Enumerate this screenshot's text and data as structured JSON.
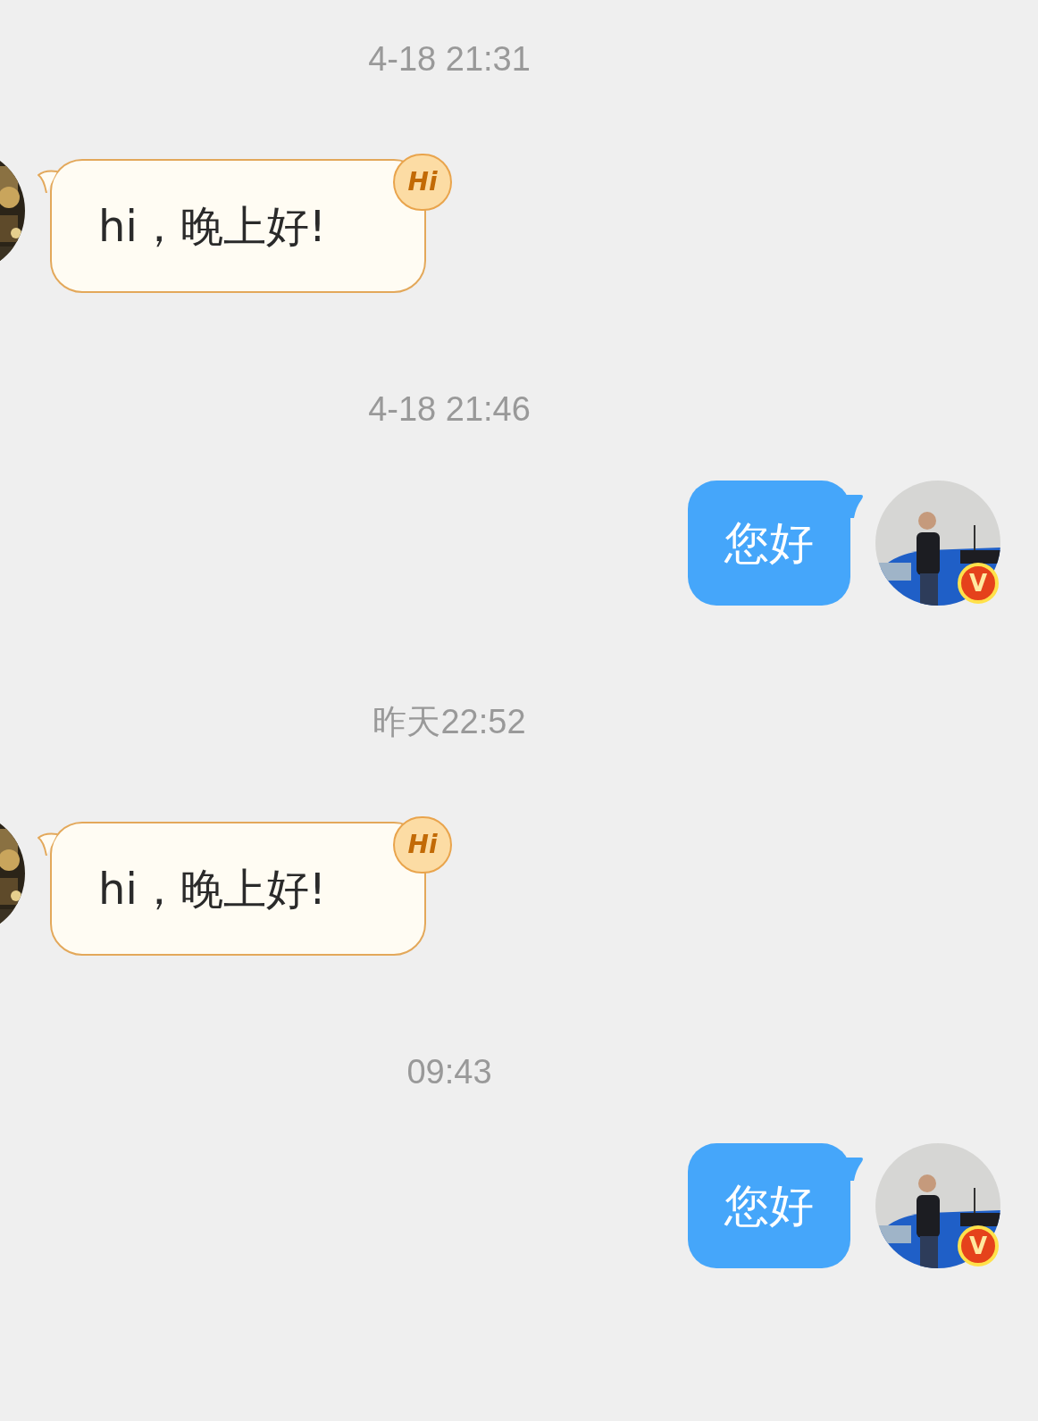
{
  "messages": [
    {
      "kind": "time",
      "text": "4-18 21:31"
    },
    {
      "kind": "incoming",
      "text": "hi，晚上好!",
      "badge": "Hi"
    },
    {
      "kind": "time",
      "text": "4-18 21:46"
    },
    {
      "kind": "outgoing",
      "text": "您好",
      "badge": "V"
    },
    {
      "kind": "time",
      "text": "昨天22:52"
    },
    {
      "kind": "incoming",
      "text": "hi，晚上好!",
      "badge": "Hi"
    },
    {
      "kind": "time",
      "text": "09:43"
    },
    {
      "kind": "outgoing",
      "text": "您好",
      "badge": "V"
    }
  ]
}
